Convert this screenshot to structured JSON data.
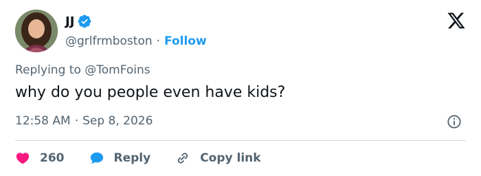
{
  "user": {
    "display_name": "JJ",
    "handle": "@grlfrmboston",
    "separator": "·",
    "follow_label": "Follow",
    "verified": true,
    "verified_color": "#1d9bf0"
  },
  "tweet": {
    "replying_prefix": "Replying to",
    "replying_to": "@TomFoins",
    "text": "why do you people even have kids?",
    "time": "12:58 AM",
    "separator": "·",
    "date": "Sep 8, 2026"
  },
  "actions": {
    "like_count": "260",
    "like_color": "#f91880",
    "reply_label": "Reply",
    "reply_color": "#1d9bf0",
    "copy_label": "Copy link"
  },
  "icons": {
    "logo": "x-logo-icon",
    "info": "info-icon",
    "like": "heart-icon",
    "reply": "speech-bubble-icon",
    "copy": "link-icon"
  }
}
